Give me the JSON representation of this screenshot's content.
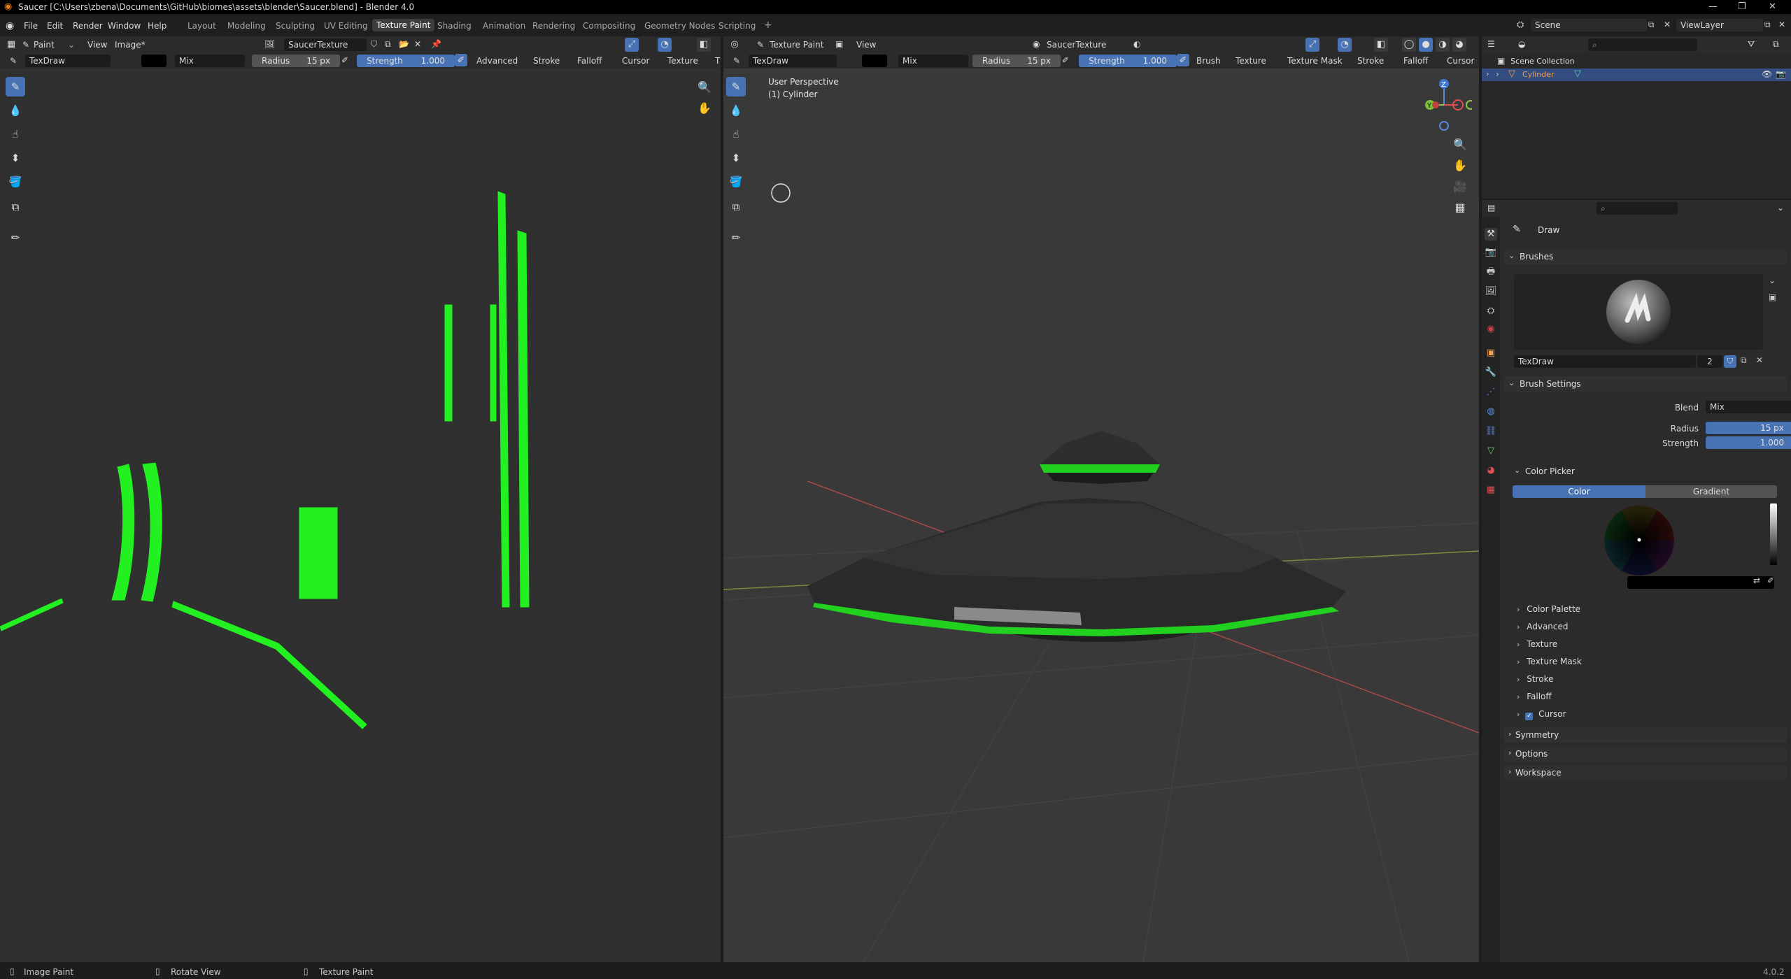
{
  "app": {
    "title": "Saucer [C:\\Users\\zbena\\Documents\\GitHub\\biomes\\assets\\blender\\Saucer.blend] - Blender 4.0",
    "version": "4.0.2"
  },
  "menu": [
    "File",
    "Edit",
    "Render",
    "Window",
    "Help"
  ],
  "workspaces": [
    "Layout",
    "Modeling",
    "Sculpting",
    "UV Editing",
    "Texture Paint",
    "Shading",
    "Animation",
    "Rendering",
    "Compositing",
    "Geometry Nodes",
    "Scripting"
  ],
  "active_workspace": "Texture Paint",
  "scene": {
    "name": "Scene",
    "view_layer": "ViewLayer"
  },
  "image_editor": {
    "mode": "Paint",
    "menus": [
      "View",
      "Image*"
    ],
    "image_name": "SaucerTexture",
    "brush": "TexDraw",
    "blend": "Mix",
    "radius_label": "Radius",
    "radius": "15 px",
    "strength_label": "Strength",
    "strength": "1.000",
    "dropdowns": [
      "Advanced",
      "Stroke",
      "Falloff",
      "Cursor",
      "Texture",
      "T"
    ]
  },
  "viewport": {
    "mode": "Texture Paint",
    "menus": [
      "View"
    ],
    "image_name": "SaucerTexture",
    "brush": "TexDraw",
    "blend": "Mix",
    "radius_label": "Radius",
    "radius": "15 px",
    "strength_label": "Strength",
    "strength": "1.000",
    "dropdowns": [
      "Brush",
      "Texture",
      "Texture Mask",
      "Stroke",
      "Falloff",
      "Cursor"
    ],
    "overlay_line1": "User Perspective",
    "overlay_line2": "(1) Cylinder",
    "gizmo": {
      "z": "Z",
      "y": "Y",
      "x": "X"
    }
  },
  "outliner": {
    "collection": "Scene Collection",
    "object": "Cylinder"
  },
  "properties": {
    "tool_name": "Draw",
    "brushes_label": "Brushes",
    "brush_name": "TexDraw",
    "brush_users": "2",
    "brush_settings_label": "Brush Settings",
    "blend_label": "Blend",
    "blend_value": "Mix",
    "radius_label": "Radius",
    "radius_value": "15 px",
    "strength_label": "Strength",
    "strength_value": "1.000",
    "color_picker_label": "Color Picker",
    "color_tab": "Color",
    "gradient_tab": "Gradient",
    "subpanels": [
      "Color Palette",
      "Advanced",
      "Texture",
      "Texture Mask",
      "Stroke",
      "Falloff",
      "Cursor"
    ],
    "panels": [
      "Symmetry",
      "Options",
      "Workspace"
    ]
  },
  "status": {
    "left": "Image Paint",
    "middle": "Rotate View",
    "right": "Texture Paint"
  },
  "colors": {
    "accent": "#4772b3",
    "paint_green": "#22f020",
    "viewport_bg": "#393939",
    "image_bg": "#303030"
  }
}
